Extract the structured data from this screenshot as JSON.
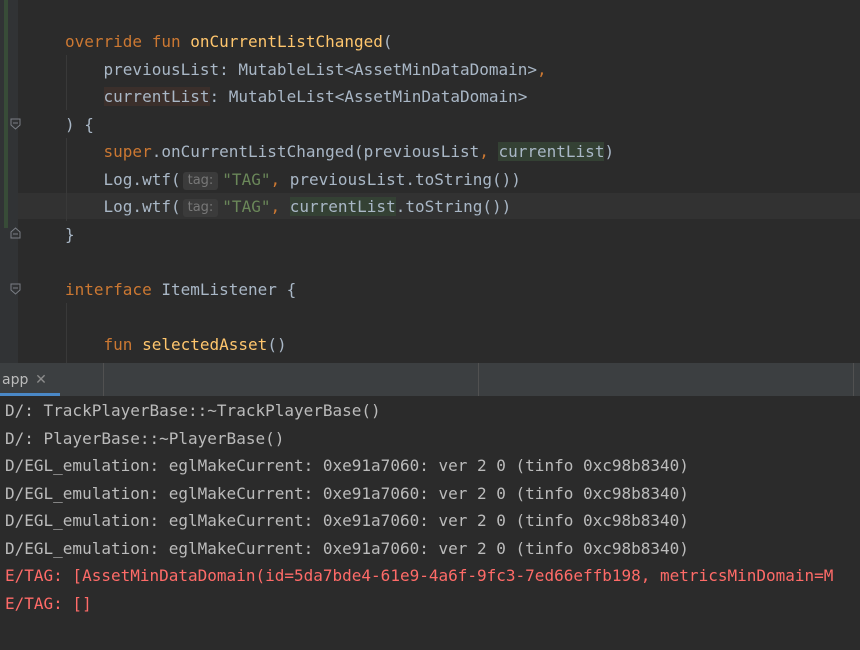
{
  "editor": {
    "lines": [
      {
        "segments": [
          {
            "text": "override",
            "style": "kw"
          },
          {
            "text": " ",
            "style": "plain"
          },
          {
            "text": "fun",
            "style": "kw"
          },
          {
            "text": " ",
            "style": "plain"
          },
          {
            "text": "onCurrentListChanged",
            "style": "fn"
          },
          {
            "text": "(",
            "style": "plain"
          }
        ]
      },
      {
        "segments": [
          {
            "text": "    previousList",
            "style": "param"
          },
          {
            "text": ": MutableList<AssetMinDataDomain>",
            "style": "type"
          },
          {
            "text": ",",
            "style": "kw"
          }
        ]
      },
      {
        "segments": [
          {
            "text": "    ",
            "style": "plain"
          },
          {
            "text": "currentList",
            "style": "param hl-read"
          },
          {
            "text": ": MutableList<AssetMinDataDomain>",
            "style": "type"
          }
        ]
      },
      {
        "segments": [
          {
            "text": ") {",
            "style": "plain"
          }
        ]
      },
      {
        "segments": [
          {
            "text": "    ",
            "style": "plain"
          },
          {
            "text": "super",
            "style": "kw"
          },
          {
            "text": ".onCurrentListChanged(previousList",
            "style": "plain"
          },
          {
            "text": ", ",
            "style": "kw"
          },
          {
            "text": "currentList",
            "style": "plain hl-write"
          },
          {
            "text": ")",
            "style": "plain"
          }
        ]
      },
      {
        "segments": [
          {
            "text": "    Log.wtf(",
            "style": "plain"
          },
          {
            "text": "tag:",
            "style": "hint"
          },
          {
            "text": "\"TAG\"",
            "style": "str"
          },
          {
            "text": ", ",
            "style": "kw"
          },
          {
            "text": "previousList.toString())",
            "style": "plain"
          }
        ]
      },
      {
        "segments": [
          {
            "text": "    Log.wtf(",
            "style": "plain"
          },
          {
            "text": "tag:",
            "style": "hint"
          },
          {
            "text": "\"TAG\"",
            "style": "str"
          },
          {
            "text": ", ",
            "style": "kw"
          },
          {
            "text": "currentList",
            "style": "plain hl-write"
          },
          {
            "text": ".toString())",
            "style": "plain"
          }
        ]
      },
      {
        "segments": [
          {
            "text": "}",
            "style": "plain"
          }
        ]
      },
      {
        "segments": []
      },
      {
        "segments": [
          {
            "text": "interface",
            "style": "kw"
          },
          {
            "text": " ItemListener {",
            "style": "plain"
          }
        ]
      },
      {
        "segments": []
      },
      {
        "segments": [
          {
            "text": "    ",
            "style": "plain"
          },
          {
            "text": "fun",
            "style": "kw"
          },
          {
            "text": " ",
            "style": "plain"
          },
          {
            "text": "selectedAsset",
            "style": "fn"
          },
          {
            "text": "()",
            "style": "plain"
          }
        ]
      }
    ]
  },
  "logcat": {
    "tab_label": "app",
    "close_glyph": "✕",
    "lines": [
      {
        "text": "D/: TrackPlayerBase::~TrackPlayerBase()",
        "level": "debug"
      },
      {
        "text": "D/: PlayerBase::~PlayerBase()",
        "level": "debug"
      },
      {
        "text": "D/EGL_emulation: eglMakeCurrent: 0xe91a7060: ver 2 0 (tinfo 0xc98b8340)",
        "level": "debug"
      },
      {
        "text": "D/EGL_emulation: eglMakeCurrent: 0xe91a7060: ver 2 0 (tinfo 0xc98b8340)",
        "level": "debug"
      },
      {
        "text": "D/EGL_emulation: eglMakeCurrent: 0xe91a7060: ver 2 0 (tinfo 0xc98b8340)",
        "level": "debug"
      },
      {
        "text": "D/EGL_emulation: eglMakeCurrent: 0xe91a7060: ver 2 0 (tinfo 0xc98b8340)",
        "level": "debug"
      },
      {
        "text": "E/TAG: [AssetMinDataDomain(id=5da7bde4-61e9-4a6f-9fc3-7ed66effb198, metricsMinDomain=M",
        "level": "error"
      },
      {
        "text": "E/TAG: []",
        "level": "error"
      }
    ]
  },
  "colors": {
    "editor_bg": "#2b2b2b",
    "keyword": "#cc7832",
    "function": "#ffc66d",
    "string": "#6a8759",
    "text": "#a9b7c6",
    "log_error": "#ff6b68",
    "tab_underline": "#4a88c7"
  }
}
